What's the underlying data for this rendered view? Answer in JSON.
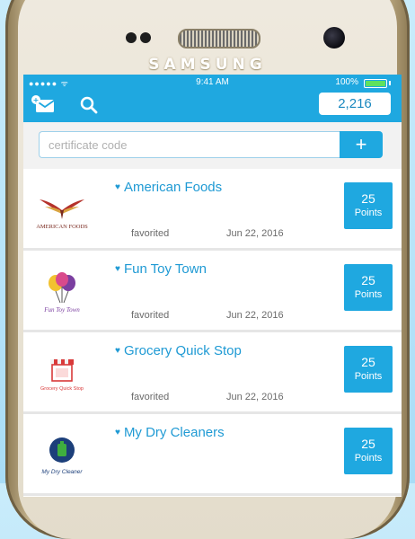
{
  "device": {
    "brand": "SAMSUNG"
  },
  "statusbar": {
    "signal": "●●●●● ᯤ",
    "time": "9:41 AM",
    "battery": "100%",
    "battery_level": 1.0
  },
  "appbar": {
    "mail_icon": "mail-badge-icon",
    "search_icon": "search-icon",
    "points_total": "2,216"
  },
  "certificate": {
    "placeholder": "certificate code",
    "add_label": "+"
  },
  "merchants": [
    {
      "name": "American Foods",
      "logo": "american-foods-logo",
      "status": "favorited",
      "date": "Jun 22, 2016",
      "points": "25",
      "points_label": "Points"
    },
    {
      "name": "Fun Toy Town",
      "logo": "fun-toy-town-logo",
      "status": "favorited",
      "date": "Jun 22, 2016",
      "points": "25",
      "points_label": "Points"
    },
    {
      "name": "Grocery Quick Stop",
      "logo": "grocery-quick-stop-logo",
      "status": "favorited",
      "date": "Jun 22, 2016",
      "points": "25",
      "points_label": "Points"
    },
    {
      "name": "My Dry Cleaners",
      "logo": "my-dry-cleaners-logo",
      "status": "",
      "date": "",
      "points": "25",
      "points_label": "Points"
    }
  ],
  "logo_text": {
    "american_foods": "AMERICAN FOODS",
    "fun_toy_town": "Fun Toy Town",
    "grocery_quick_stop": "Grocery Quick Stop",
    "my_dry_cleaners": "My Dry Cleaner"
  },
  "colors": {
    "accent": "#1fa8e0",
    "name_text": "#1f9ad4",
    "background": "#a8dcf6"
  }
}
